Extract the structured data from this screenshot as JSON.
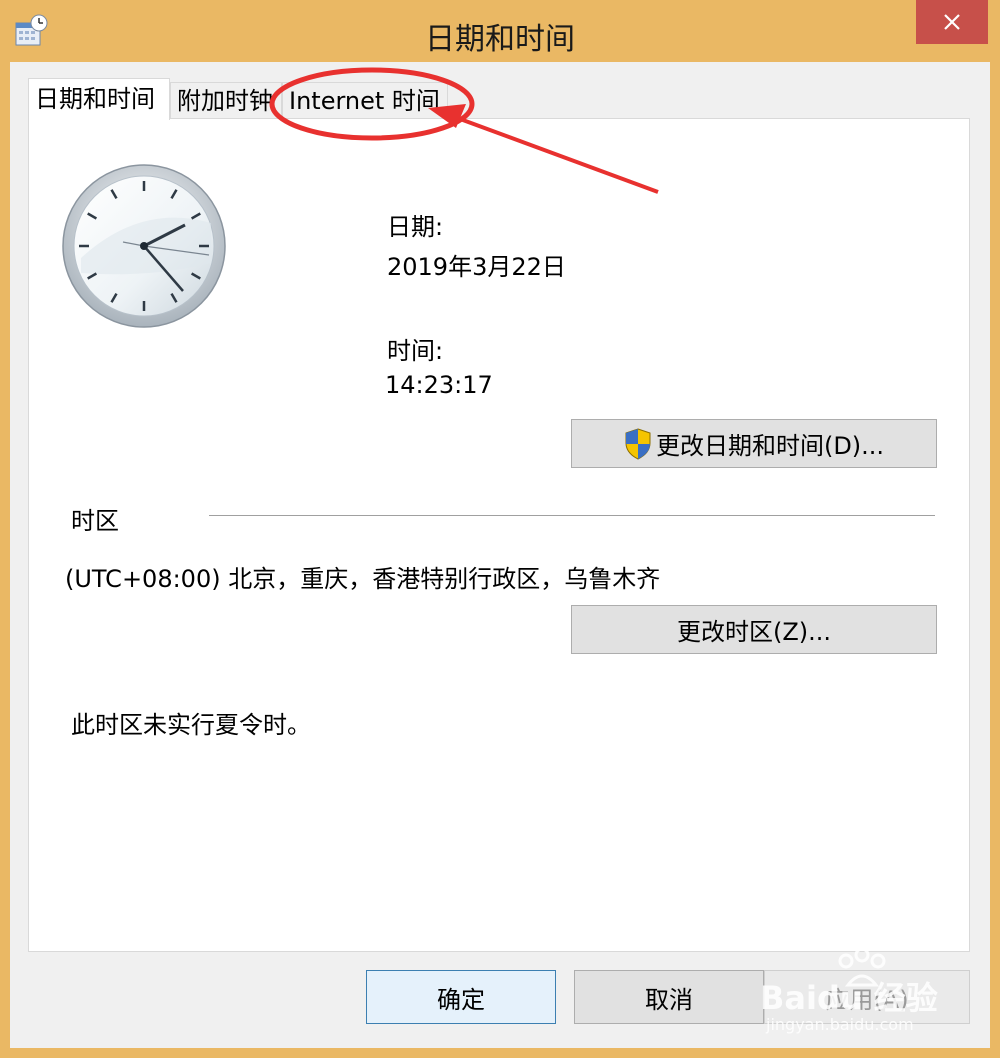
{
  "window": {
    "title": "日期和时间",
    "close_icon": "close-icon"
  },
  "tabs": [
    {
      "label": "日期和时间",
      "active": true
    },
    {
      "label": "附加时钟",
      "active": false
    },
    {
      "label": "Internet 时间",
      "active": false
    }
  ],
  "date": {
    "label": "日期:",
    "value": "2019年3月22日"
  },
  "time": {
    "label": "时间:",
    "value": "14:23:17"
  },
  "change_datetime_button": "更改日期和时间(D)...",
  "timezone": {
    "section_label": "时区",
    "value": "(UTC+08:00) 北京，重庆，香港特别行政区，乌鲁木齐",
    "change_button": "更改时区(Z)...",
    "dst_note": "此时区未实行夏令时。"
  },
  "footer": {
    "ok": "确定",
    "cancel": "取消",
    "apply": "应用(A)"
  },
  "watermark": {
    "brand": "Baidu 经验",
    "url": "jingyan.baidu.com"
  },
  "colors": {
    "frame": "#eab864",
    "close": "#c7504a",
    "annotation": "#e8312f"
  }
}
